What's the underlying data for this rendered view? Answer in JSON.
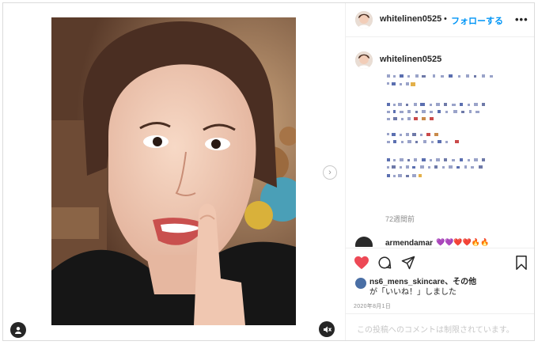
{
  "header": {
    "username": "whitelinen0525",
    "separator": "•",
    "follow_label": "フォローする",
    "more_label": "•••"
  },
  "caption": {
    "username": "whitelinen0525",
    "time_ago": "72週間前"
  },
  "comment": {
    "username": "armendamar",
    "emoji": "💜💜❤️❤️🔥🔥"
  },
  "likes": {
    "users": "ns6_mens_skincare、",
    "others": "その他",
    "suffix": "が「いいね！」しました"
  },
  "post_date": "2020年8月1日",
  "comment_box": {
    "text": "この投稿へのコメントは制限されています。"
  },
  "icons": {
    "heart": "heart-icon",
    "comment": "comment-icon",
    "share": "share-icon",
    "bookmark": "bookmark-icon",
    "user": "user-icon",
    "mute": "mute-icon",
    "next": "chevron-right-icon"
  },
  "colors": {
    "like": "#ed4956",
    "follow": "#0095f6",
    "muted": "#8e8e8e"
  }
}
